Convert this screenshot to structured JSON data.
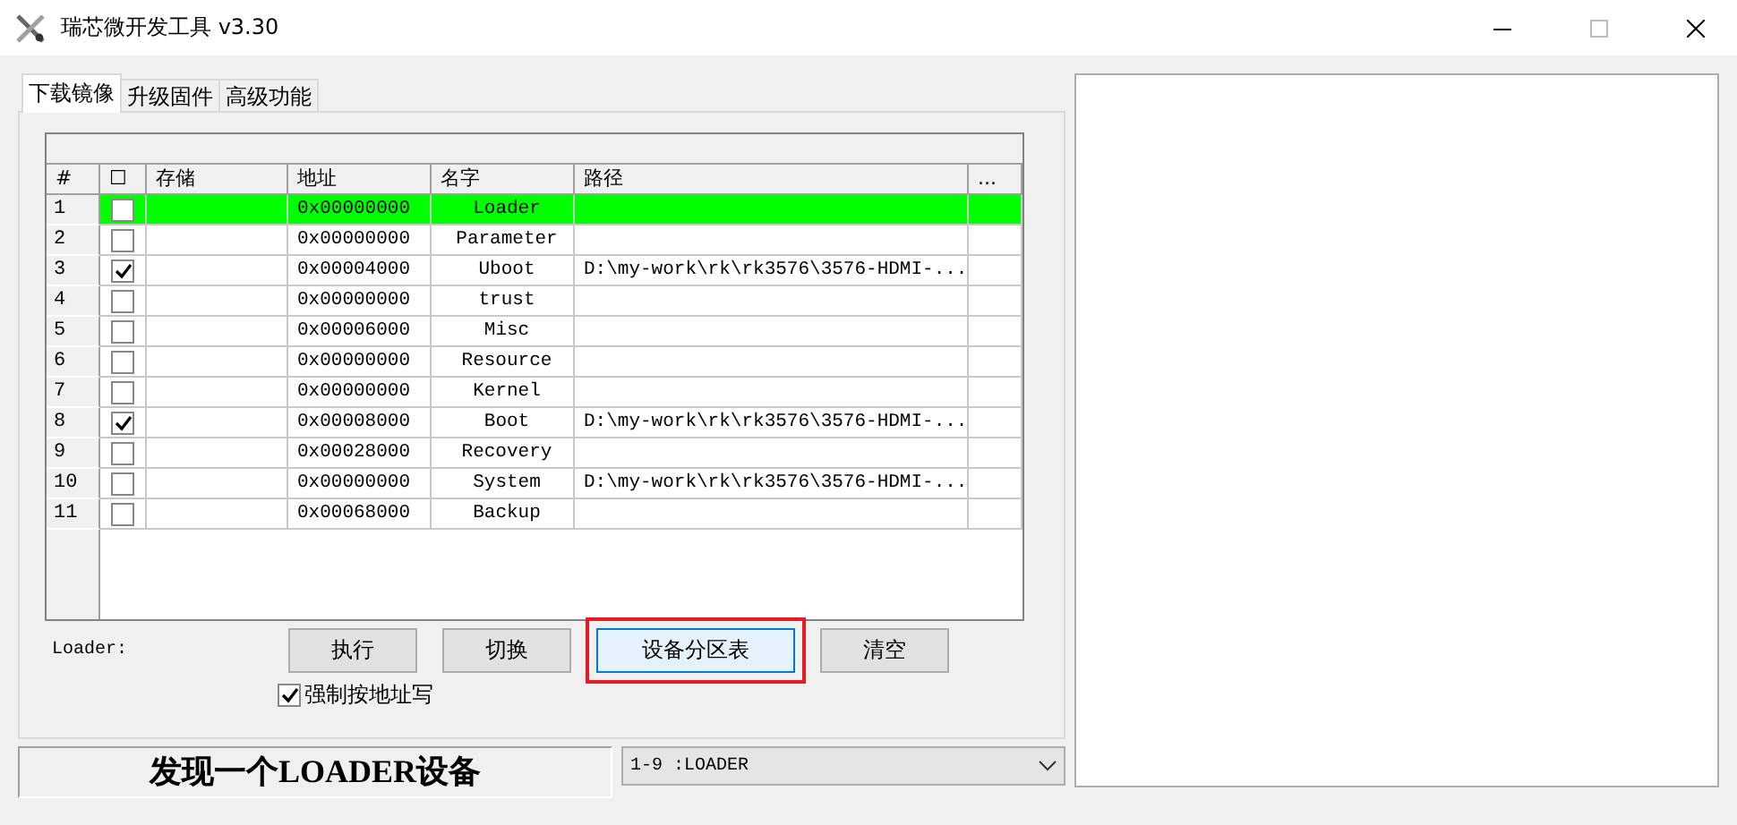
{
  "window": {
    "title": "瑞芯微开发工具 v3.30"
  },
  "tabs": [
    {
      "label": "下载镜像",
      "selected": true
    },
    {
      "label": "升级固件",
      "selected": false
    },
    {
      "label": "高级功能",
      "selected": false
    }
  ],
  "table": {
    "columns": [
      "#",
      "☐",
      "存储",
      "地址",
      "名字",
      "路径",
      "..."
    ],
    "rows": [
      {
        "index": "1",
        "checked": false,
        "selected": true,
        "address": "0x00000000",
        "name": "Loader",
        "path": ""
      },
      {
        "index": "2",
        "checked": false,
        "selected": false,
        "address": "0x00000000",
        "name": "Parameter",
        "path": ""
      },
      {
        "index": "3",
        "checked": true,
        "selected": false,
        "address": "0x00004000",
        "name": "Uboot",
        "path": "D:\\my-work\\rk\\rk3576\\3576-HDMI-..."
      },
      {
        "index": "4",
        "checked": false,
        "selected": false,
        "address": "0x00000000",
        "name": "trust",
        "path": ""
      },
      {
        "index": "5",
        "checked": false,
        "selected": false,
        "address": "0x00006000",
        "name": "Misc",
        "path": ""
      },
      {
        "index": "6",
        "checked": false,
        "selected": false,
        "address": "0x00000000",
        "name": "Resource",
        "path": ""
      },
      {
        "index": "7",
        "checked": false,
        "selected": false,
        "address": "0x00000000",
        "name": "Kernel",
        "path": ""
      },
      {
        "index": "8",
        "checked": true,
        "selected": false,
        "address": "0x00008000",
        "name": "Boot",
        "path": "D:\\my-work\\rk\\rk3576\\3576-HDMI-..."
      },
      {
        "index": "9",
        "checked": false,
        "selected": false,
        "address": "0x00028000",
        "name": "Recovery",
        "path": ""
      },
      {
        "index": "10",
        "checked": false,
        "selected": false,
        "address": "0x00000000",
        "name": "System",
        "path": "D:\\my-work\\rk\\rk3576\\3576-HDMI-..."
      },
      {
        "index": "11",
        "checked": false,
        "selected": false,
        "address": "0x00068000",
        "name": "Backup",
        "path": ""
      }
    ]
  },
  "loader_label": "Loader:",
  "buttons": [
    {
      "label": "执行",
      "highlighted": false
    },
    {
      "label": "切换",
      "highlighted": false
    },
    {
      "label": "设备分区表",
      "highlighted": true
    },
    {
      "label": "清空",
      "highlighted": false
    }
  ],
  "force_address": {
    "label": "强制按地址写",
    "checked": true
  },
  "status": {
    "message": "发现一个LOADER设备",
    "device": "1-9 :LOADER"
  }
}
